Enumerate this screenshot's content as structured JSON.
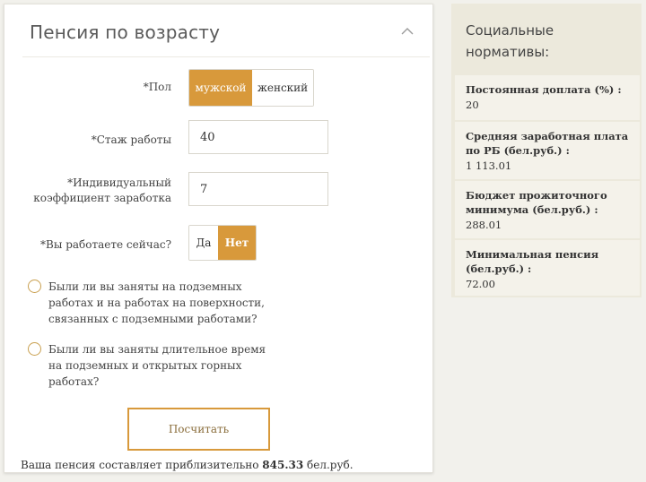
{
  "form": {
    "title": "Пенсия по возрасту",
    "gender": {
      "label": "*Пол",
      "options": [
        "мужской",
        "женский"
      ],
      "selected": "мужской"
    },
    "experience": {
      "label": "*Стаж работы",
      "value": "40"
    },
    "coefficient": {
      "label_line1": "*Индивидуальный",
      "label_line2": "коэффициент заработка",
      "value": "7"
    },
    "working": {
      "label": "*Вы работаете сейчас?",
      "options": [
        "Да",
        "Нет"
      ],
      "selected": "Нет"
    },
    "underground": {
      "line1": "Были ли вы заняты на подземных",
      "line2": "работах и на работах на поверхности,",
      "line3": "связанных с подземными работами?"
    },
    "mining": {
      "line1": "Были ли вы заняты длительное время",
      "line2": "на подземных и открытых горных",
      "line3": "работах?"
    },
    "calculate_label": "Посчитать",
    "result": {
      "prefix": "Ваша пенсия составляет приблизительно",
      "amount": "845.33",
      "suffix": "бел.руб."
    }
  },
  "sidebar": {
    "title": "Социальные нормативы:",
    "items": [
      {
        "key": "Постоянная доплата (%) :",
        "value": "20"
      },
      {
        "key": "Средняя заработная плата по РБ (бел.руб.) :",
        "value": "1 113.01"
      },
      {
        "key": "Бюджет прожиточного минимума (бел.руб.) :",
        "value": "288.01"
      },
      {
        "key": "Минимальная пенсия (бел.руб.) :",
        "value": "72.00"
      }
    ]
  },
  "colors": {
    "accent": "#d8993b",
    "sidebar_bg": "#ece9dc",
    "sidebar_item_bg": "#f4f2ea"
  },
  "icons": {
    "collapse": "chevron-up-icon",
    "radio": "radio-icon"
  }
}
